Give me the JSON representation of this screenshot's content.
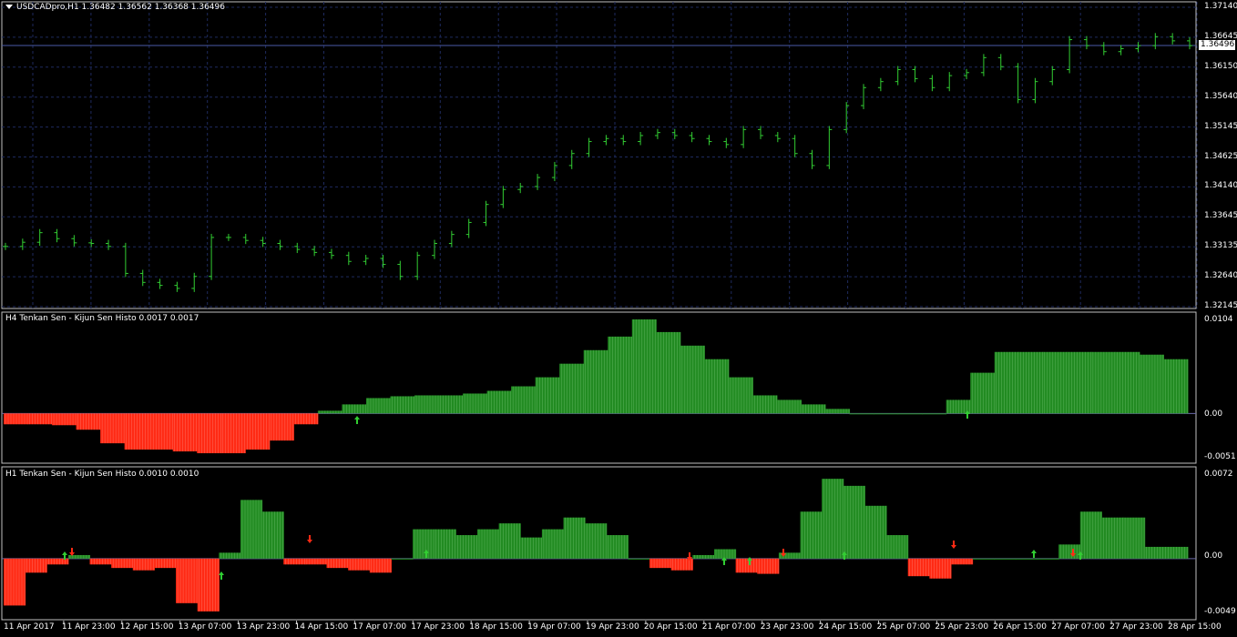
{
  "main_panel": {
    "title": "USDCADpro,H1  1.36482 1.36562 1.36368 1.36496",
    "current_price": "1.36496",
    "y_labels": [
      "1.37140",
      "1.36645",
      "1.36150",
      "1.35640",
      "1.35145",
      "1.34625",
      "1.34140",
      "1.33645",
      "1.33135",
      "1.32640",
      "1.32145"
    ]
  },
  "h4_panel": {
    "title": "H4  Tenkan Sen - Kijun Sen Histo 0.0017 0.0017",
    "y_labels": [
      "0.0104",
      "0.00",
      "-0.0051"
    ]
  },
  "h1_panel": {
    "title": "H1  Tenkan Sen - Kijun Sen Histo 0.0010 0.0010",
    "y_labels": [
      "0.0072",
      "0.00",
      "-0.0049"
    ]
  },
  "x_labels": [
    "11 Apr 2017",
    "11 Apr 23:00",
    "12 Apr 15:00",
    "13 Apr 07:00",
    "13 Apr 23:00",
    "14 Apr 15:00",
    "17 Apr 07:00",
    "17 Apr 23:00",
    "18 Apr 15:00",
    "19 Apr 07:00",
    "19 Apr 23:00",
    "20 Apr 15:00",
    "21 Apr 07:00",
    "23 Apr 23:00",
    "24 Apr 15:00",
    "25 Apr 07:00",
    "25 Apr 23:00",
    "26 Apr 15:00",
    "27 Apr 07:00",
    "27 Apr 23:00",
    "28 Apr 15:00"
  ],
  "colors": {
    "background": "#000000",
    "candles": "#32cd32",
    "hist_positive": "#228b22",
    "hist_negative": "#ff2a14",
    "grid": "#1e2a5e",
    "arrow_up": "#32cd32",
    "arrow_down": "#ff2a14"
  },
  "chart_data": [
    {
      "type": "line",
      "series": [
        {
          "values": [
            1.3315,
            1.3322,
            1.3338,
            1.3328,
            1.3321,
            1.332,
            1.3315,
            1.327,
            1.3255,
            1.325,
            1.3245,
            1.3265,
            1.333,
            1.333,
            1.3325,
            1.332,
            1.3315,
            1.331,
            1.3305,
            1.33,
            1.329,
            1.3295,
            1.3285,
            1.3265,
            1.33,
            1.332,
            1.3335,
            1.3355,
            1.3385,
            1.341,
            1.3415,
            1.343,
            1.345,
            1.347,
            1.349,
            1.3495,
            1.349,
            1.35,
            1.3505,
            1.35,
            1.3495,
            1.349,
            1.3485,
            1.351,
            1.35,
            1.3495,
            1.347,
            1.345,
            1.351,
            1.355,
            1.358,
            1.359,
            1.361,
            1.3595,
            1.358,
            1.36,
            1.3605,
            1.363,
            1.3615,
            1.356,
            1.359,
            1.361,
            1.366,
            1.365,
            1.364,
            1.3645,
            1.365,
            1.3665,
            1.3658,
            1.365
          ]
        }
      ],
      "ylim": [
        1.32145,
        1.3714
      ]
    },
    {
      "type": "bar",
      "series": [
        {
          "values": [
            -0.0012,
            -0.0012,
            -0.0013,
            -0.0018,
            -0.0033,
            -0.004,
            -0.004,
            -0.0042,
            -0.0044,
            -0.0044,
            -0.004,
            -0.003,
            -0.0012,
            0.0003,
            0.001,
            0.0017,
            0.0019,
            0.002,
            0.002,
            0.0022,
            0.0025,
            0.003,
            0.004,
            0.0055,
            0.007,
            0.0085,
            0.0104,
            0.009,
            0.0075,
            0.006,
            0.004,
            0.002,
            0.0015,
            0.001,
            0.0005,
            0.0,
            0.0,
            0.0,
            0.0,
            0.0015,
            0.0045,
            0.0068,
            0.0068,
            0.0068,
            0.0068,
            0.0068,
            0.0068,
            0.0065,
            0.006
          ]
        }
      ],
      "ylim": [
        -0.0051,
        0.0104
      ]
    },
    {
      "type": "bar",
      "series": [
        {
          "values": [
            -0.004,
            -0.0012,
            -0.0005,
            0.0003,
            -0.0005,
            -0.0008,
            -0.001,
            -0.0008,
            -0.0038,
            -0.0045,
            0.0005,
            0.005,
            0.004,
            -0.0005,
            -0.0005,
            -0.0008,
            -0.001,
            -0.0012,
            0.0,
            0.0025,
            0.0025,
            0.002,
            0.0025,
            0.003,
            0.0018,
            0.0025,
            0.0035,
            0.003,
            0.002,
            0.0,
            -0.0008,
            -0.001,
            0.0003,
            0.0008,
            -0.0012,
            -0.0013,
            0.0005,
            0.004,
            0.0068,
            0.0062,
            0.0045,
            0.002,
            -0.0015,
            -0.0017,
            -0.0005,
            0.0,
            0.0,
            0.0,
            0.0,
            0.0012,
            0.004,
            0.0035,
            0.0035,
            0.001,
            0.001
          ]
        }
      ],
      "ylim": [
        -0.0049,
        0.0072
      ]
    }
  ]
}
